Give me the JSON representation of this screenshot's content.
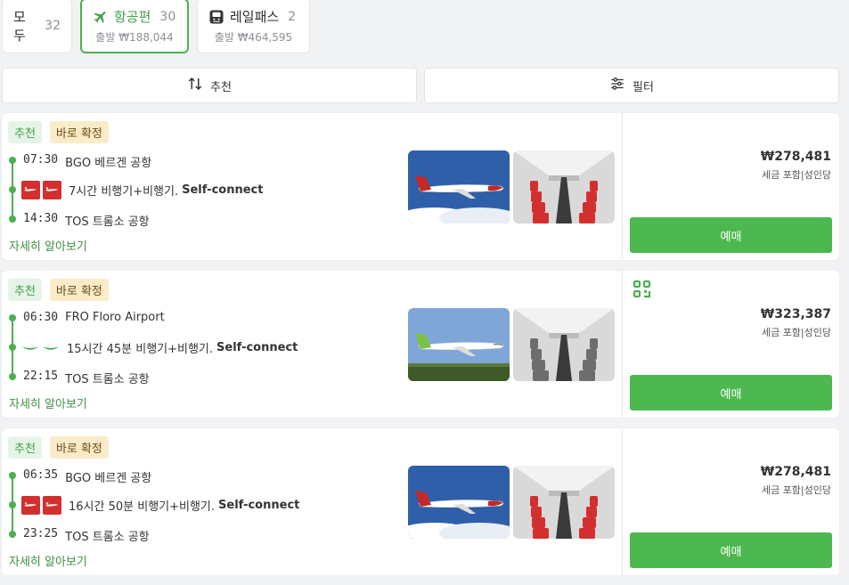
{
  "tabs": [
    {
      "label": "모두",
      "count": "32"
    },
    {
      "label": "항공편",
      "count": "30",
      "sub": "출발 ₩188,044",
      "icon": "plane-icon"
    },
    {
      "label": "레일패스",
      "count": "2",
      "sub": "출발 ₩464,595",
      "icon": "train-icon"
    }
  ],
  "sort_label": "추천",
  "filter_label": "필터",
  "colors": {
    "accent": "#4caf50",
    "badge_rec_bg": "#e6f4e7",
    "badge_conf_bg": "#fbecc9",
    "button": "#4cb84f"
  },
  "results": [
    {
      "badges": [
        "추천",
        "바로 확정"
      ],
      "dep_time": "07:30",
      "dep_place": "BGO 베르겐 공항",
      "duration": "7시간 비행기+비행기.",
      "connect": "Self-connect",
      "arr_time": "14:30",
      "arr_place": "TOS 트롬소 공항",
      "more": "자세히 알아보기",
      "price": "₩278,481",
      "price_note": "세금 포함|성인당",
      "buy": "예매",
      "airline": "norwegian"
    },
    {
      "badges": [
        "추천",
        "바로 확정"
      ],
      "dep_time": "06:30",
      "dep_place": "FRO Floro Airport",
      "duration": "15시간 45분 비행기+비행기.",
      "connect": "Self-connect",
      "arr_time": "22:15",
      "arr_place": "TOS 트롬소 공항",
      "more": "자세히 알아보기",
      "price": "₩323,387",
      "price_note": "세금 포함|성인당",
      "buy": "예매",
      "airline": "wideroe"
    },
    {
      "badges": [
        "추천",
        "바로 확정"
      ],
      "dep_time": "06:35",
      "dep_place": "BGO 베르겐 공항",
      "duration": "16시간 50분 비행기+비행기.",
      "connect": "Self-connect",
      "arr_time": "23:25",
      "arr_place": "TOS 트롬소 공항",
      "more": "자세히 알아보기",
      "price": "₩278,481",
      "price_note": "세금 포함|성인당",
      "buy": "예매",
      "airline": "norwegian"
    }
  ]
}
